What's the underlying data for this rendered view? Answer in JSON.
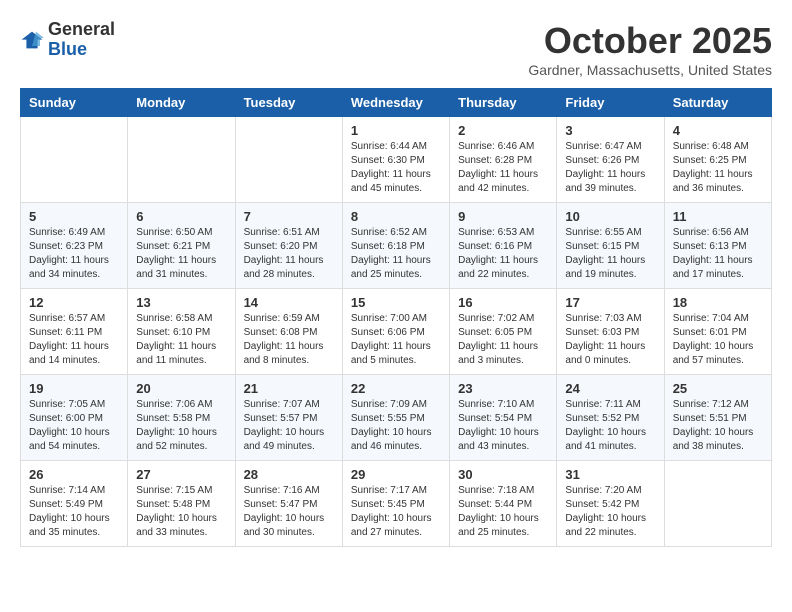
{
  "header": {
    "logo_general": "General",
    "logo_blue": "Blue",
    "month_title": "October 2025",
    "location": "Gardner, Massachusetts, United States"
  },
  "days_of_week": [
    "Sunday",
    "Monday",
    "Tuesday",
    "Wednesday",
    "Thursday",
    "Friday",
    "Saturday"
  ],
  "weeks": [
    [
      {
        "day": "",
        "info": ""
      },
      {
        "day": "",
        "info": ""
      },
      {
        "day": "",
        "info": ""
      },
      {
        "day": "1",
        "info": "Sunrise: 6:44 AM\nSunset: 6:30 PM\nDaylight: 11 hours\nand 45 minutes."
      },
      {
        "day": "2",
        "info": "Sunrise: 6:46 AM\nSunset: 6:28 PM\nDaylight: 11 hours\nand 42 minutes."
      },
      {
        "day": "3",
        "info": "Sunrise: 6:47 AM\nSunset: 6:26 PM\nDaylight: 11 hours\nand 39 minutes."
      },
      {
        "day": "4",
        "info": "Sunrise: 6:48 AM\nSunset: 6:25 PM\nDaylight: 11 hours\nand 36 minutes."
      }
    ],
    [
      {
        "day": "5",
        "info": "Sunrise: 6:49 AM\nSunset: 6:23 PM\nDaylight: 11 hours\nand 34 minutes."
      },
      {
        "day": "6",
        "info": "Sunrise: 6:50 AM\nSunset: 6:21 PM\nDaylight: 11 hours\nand 31 minutes."
      },
      {
        "day": "7",
        "info": "Sunrise: 6:51 AM\nSunset: 6:20 PM\nDaylight: 11 hours\nand 28 minutes."
      },
      {
        "day": "8",
        "info": "Sunrise: 6:52 AM\nSunset: 6:18 PM\nDaylight: 11 hours\nand 25 minutes."
      },
      {
        "day": "9",
        "info": "Sunrise: 6:53 AM\nSunset: 6:16 PM\nDaylight: 11 hours\nand 22 minutes."
      },
      {
        "day": "10",
        "info": "Sunrise: 6:55 AM\nSunset: 6:15 PM\nDaylight: 11 hours\nand 19 minutes."
      },
      {
        "day": "11",
        "info": "Sunrise: 6:56 AM\nSunset: 6:13 PM\nDaylight: 11 hours\nand 17 minutes."
      }
    ],
    [
      {
        "day": "12",
        "info": "Sunrise: 6:57 AM\nSunset: 6:11 PM\nDaylight: 11 hours\nand 14 minutes."
      },
      {
        "day": "13",
        "info": "Sunrise: 6:58 AM\nSunset: 6:10 PM\nDaylight: 11 hours\nand 11 minutes."
      },
      {
        "day": "14",
        "info": "Sunrise: 6:59 AM\nSunset: 6:08 PM\nDaylight: 11 hours\nand 8 minutes."
      },
      {
        "day": "15",
        "info": "Sunrise: 7:00 AM\nSunset: 6:06 PM\nDaylight: 11 hours\nand 5 minutes."
      },
      {
        "day": "16",
        "info": "Sunrise: 7:02 AM\nSunset: 6:05 PM\nDaylight: 11 hours\nand 3 minutes."
      },
      {
        "day": "17",
        "info": "Sunrise: 7:03 AM\nSunset: 6:03 PM\nDaylight: 11 hours\nand 0 minutes."
      },
      {
        "day": "18",
        "info": "Sunrise: 7:04 AM\nSunset: 6:01 PM\nDaylight: 10 hours\nand 57 minutes."
      }
    ],
    [
      {
        "day": "19",
        "info": "Sunrise: 7:05 AM\nSunset: 6:00 PM\nDaylight: 10 hours\nand 54 minutes."
      },
      {
        "day": "20",
        "info": "Sunrise: 7:06 AM\nSunset: 5:58 PM\nDaylight: 10 hours\nand 52 minutes."
      },
      {
        "day": "21",
        "info": "Sunrise: 7:07 AM\nSunset: 5:57 PM\nDaylight: 10 hours\nand 49 minutes."
      },
      {
        "day": "22",
        "info": "Sunrise: 7:09 AM\nSunset: 5:55 PM\nDaylight: 10 hours\nand 46 minutes."
      },
      {
        "day": "23",
        "info": "Sunrise: 7:10 AM\nSunset: 5:54 PM\nDaylight: 10 hours\nand 43 minutes."
      },
      {
        "day": "24",
        "info": "Sunrise: 7:11 AM\nSunset: 5:52 PM\nDaylight: 10 hours\nand 41 minutes."
      },
      {
        "day": "25",
        "info": "Sunrise: 7:12 AM\nSunset: 5:51 PM\nDaylight: 10 hours\nand 38 minutes."
      }
    ],
    [
      {
        "day": "26",
        "info": "Sunrise: 7:14 AM\nSunset: 5:49 PM\nDaylight: 10 hours\nand 35 minutes."
      },
      {
        "day": "27",
        "info": "Sunrise: 7:15 AM\nSunset: 5:48 PM\nDaylight: 10 hours\nand 33 minutes."
      },
      {
        "day": "28",
        "info": "Sunrise: 7:16 AM\nSunset: 5:47 PM\nDaylight: 10 hours\nand 30 minutes."
      },
      {
        "day": "29",
        "info": "Sunrise: 7:17 AM\nSunset: 5:45 PM\nDaylight: 10 hours\nand 27 minutes."
      },
      {
        "day": "30",
        "info": "Sunrise: 7:18 AM\nSunset: 5:44 PM\nDaylight: 10 hours\nand 25 minutes."
      },
      {
        "day": "31",
        "info": "Sunrise: 7:20 AM\nSunset: 5:42 PM\nDaylight: 10 hours\nand 22 minutes."
      },
      {
        "day": "",
        "info": ""
      }
    ]
  ]
}
